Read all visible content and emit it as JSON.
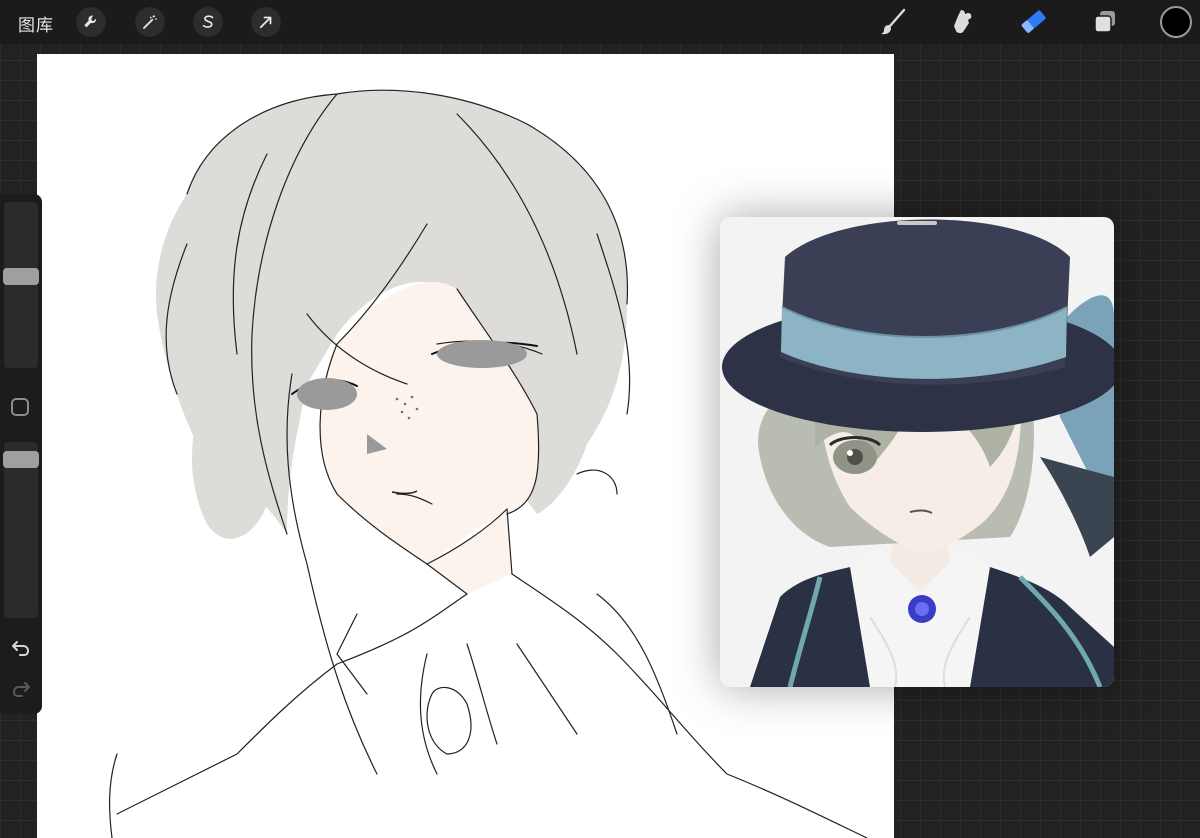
{
  "toolbar": {
    "gallery_label": "图库",
    "left_tools": [
      {
        "name": "actions",
        "icon": "wrench-icon"
      },
      {
        "name": "adjustments",
        "icon": "magic-wand-icon"
      },
      {
        "name": "selection",
        "icon": "selection-s-icon"
      },
      {
        "name": "transform",
        "icon": "arrow-cursor-icon"
      }
    ],
    "right_tools": [
      {
        "name": "brush",
        "icon": "brush-icon",
        "active": false
      },
      {
        "name": "smudge",
        "icon": "smudge-finger-icon",
        "active": false
      },
      {
        "name": "eraser",
        "icon": "eraser-icon",
        "active": true
      },
      {
        "name": "layers",
        "icon": "layers-icon",
        "active": false
      }
    ],
    "active_color": "#000000",
    "accent_color": "#2f7bf5"
  },
  "sidebar": {
    "brush_size_level": 0.55,
    "opacity_level": 0.95,
    "undo_icon": "undo-icon",
    "redo_icon": "redo-icon"
  },
  "reference_window": {
    "visible": true,
    "content": "character-reference-image"
  }
}
